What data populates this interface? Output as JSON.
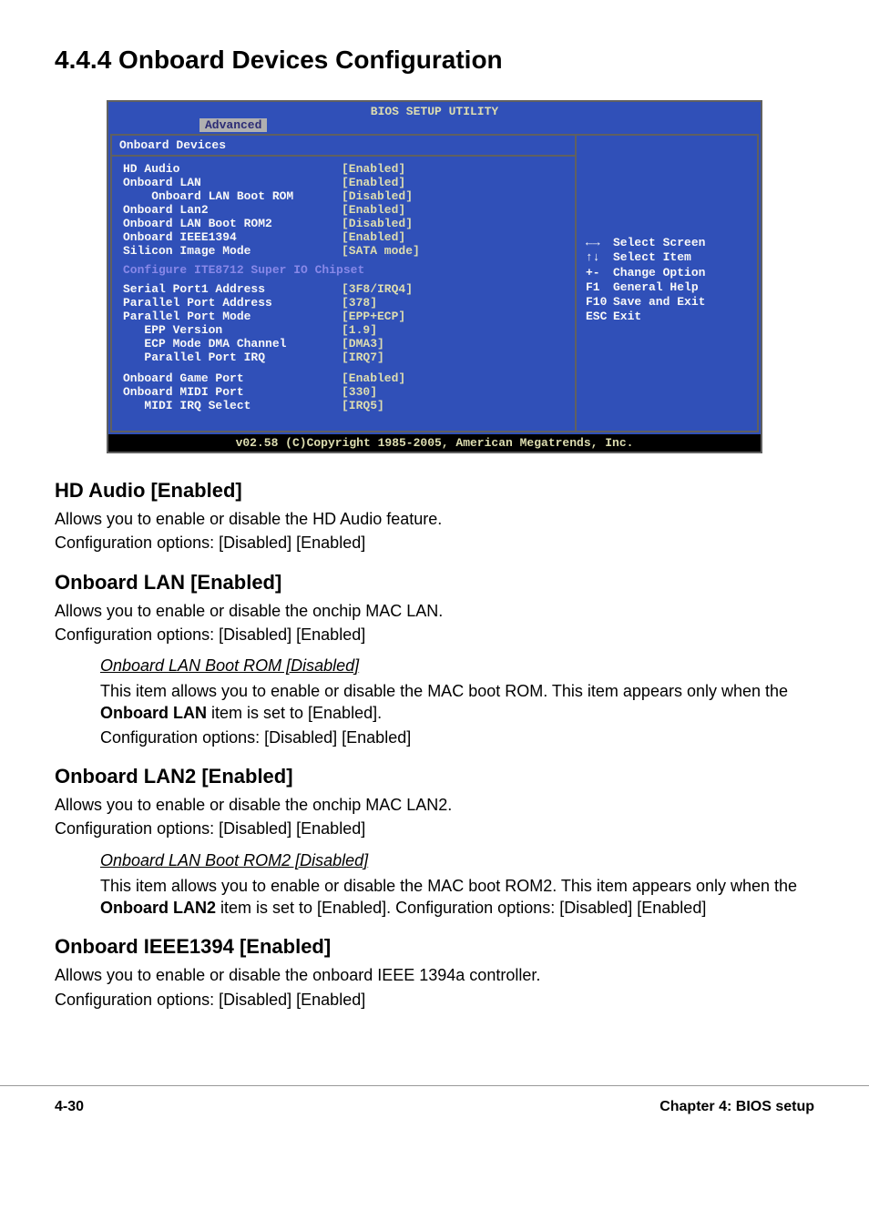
{
  "heading": "4.4.4   Onboard Devices Configuration",
  "bios": {
    "title": "BIOS SETUP UTILITY",
    "tab": "Advanced",
    "section_label": "Onboard Devices",
    "rows1": [
      {
        "label": "HD Audio",
        "value": "[Enabled]"
      },
      {
        "label": "Onboard LAN",
        "value": "[Enabled]"
      },
      {
        "label": "    Onboard LAN Boot ROM",
        "value": "[Disabled]"
      },
      {
        "label": "Onboard Lan2",
        "value": "[Enabled]"
      },
      {
        "label": "Onboard LAN Boot ROM2",
        "value": "[Disabled]"
      },
      {
        "label": "Onboard IEEE1394",
        "value": "[Enabled]"
      },
      {
        "label": "Silicon Image Mode",
        "value": "[SATA mode]"
      }
    ],
    "subhead": "Configure ITE8712 Super IO Chipset",
    "rows2": [
      {
        "label": "Serial Port1 Address",
        "value": "[3F8/IRQ4]"
      },
      {
        "label": "Parallel Port Address",
        "value": "[378]"
      },
      {
        "label": "Parallel Port Mode",
        "value": "[EPP+ECP]"
      },
      {
        "label": "   EPP Version",
        "value": "[1.9]"
      },
      {
        "label": "   ECP Mode DMA Channel",
        "value": "[DMA3]"
      },
      {
        "label": "   Parallel Port IRQ",
        "value": "[IRQ7]"
      }
    ],
    "rows3": [
      {
        "label": "Onboard Game Port",
        "value": "[Enabled]"
      },
      {
        "label": "Onboard MIDI Port",
        "value": "[330]"
      },
      {
        "label": "   MIDI IRQ Select",
        "value": "[IRQ5]"
      }
    ],
    "help": [
      {
        "key": "←→",
        "text": "Select Screen"
      },
      {
        "key": "↑↓",
        "text": "Select Item"
      },
      {
        "key": "+-",
        "text": "Change Option"
      },
      {
        "key": "F1",
        "text": "General Help"
      },
      {
        "key": "F10",
        "text": "Save and Exit"
      },
      {
        "key": "ESC",
        "text": "Exit"
      }
    ],
    "copyright": "v02.58 (C)Copyright 1985-2005, American Megatrends, Inc."
  },
  "sections": {
    "hd_audio": {
      "title": "HD Audio [Enabled]",
      "p1": "Allows you to enable or disable the HD Audio feature.",
      "p2": "Configuration options: [Disabled] [Enabled]"
    },
    "onboard_lan": {
      "title": "Onboard LAN [Enabled]",
      "p1": "Allows you to enable or disable the onchip MAC LAN.",
      "p2": "Configuration options: [Disabled] [Enabled]",
      "sub_title": "Onboard LAN Boot ROM [Disabled]",
      "sub_p1a": "This item allows you to enable or disable the MAC boot ROM. This item appears only when the ",
      "sub_bold": "Onboard LAN",
      "sub_p1b": " item is set to [Enabled].",
      "sub_p2": "Configuration options: [Disabled] [Enabled]"
    },
    "onboard_lan2": {
      "title": "Onboard LAN2 [Enabled]",
      "p1": "Allows you to enable or disable the onchip MAC LAN2.",
      "p2": "Configuration options: [Disabled] [Enabled]",
      "sub_title": "Onboard LAN Boot ROM2 [Disabled]",
      "sub_p1a": "This item allows you to enable or disable the MAC boot ROM2. This item appears only when the ",
      "sub_bold": "Onboard LAN2",
      "sub_p1b": " item is set to [Enabled]. Configuration options: [Disabled] [Enabled]"
    },
    "ieee1394": {
      "title": "Onboard IEEE1394 [Enabled]",
      "p1": "Allows you to enable or disable the onboard IEEE 1394a controller.",
      "p2": "Configuration options: [Disabled] [Enabled]"
    }
  },
  "footer": {
    "left": "4-30",
    "right": "Chapter 4: BIOS setup"
  }
}
